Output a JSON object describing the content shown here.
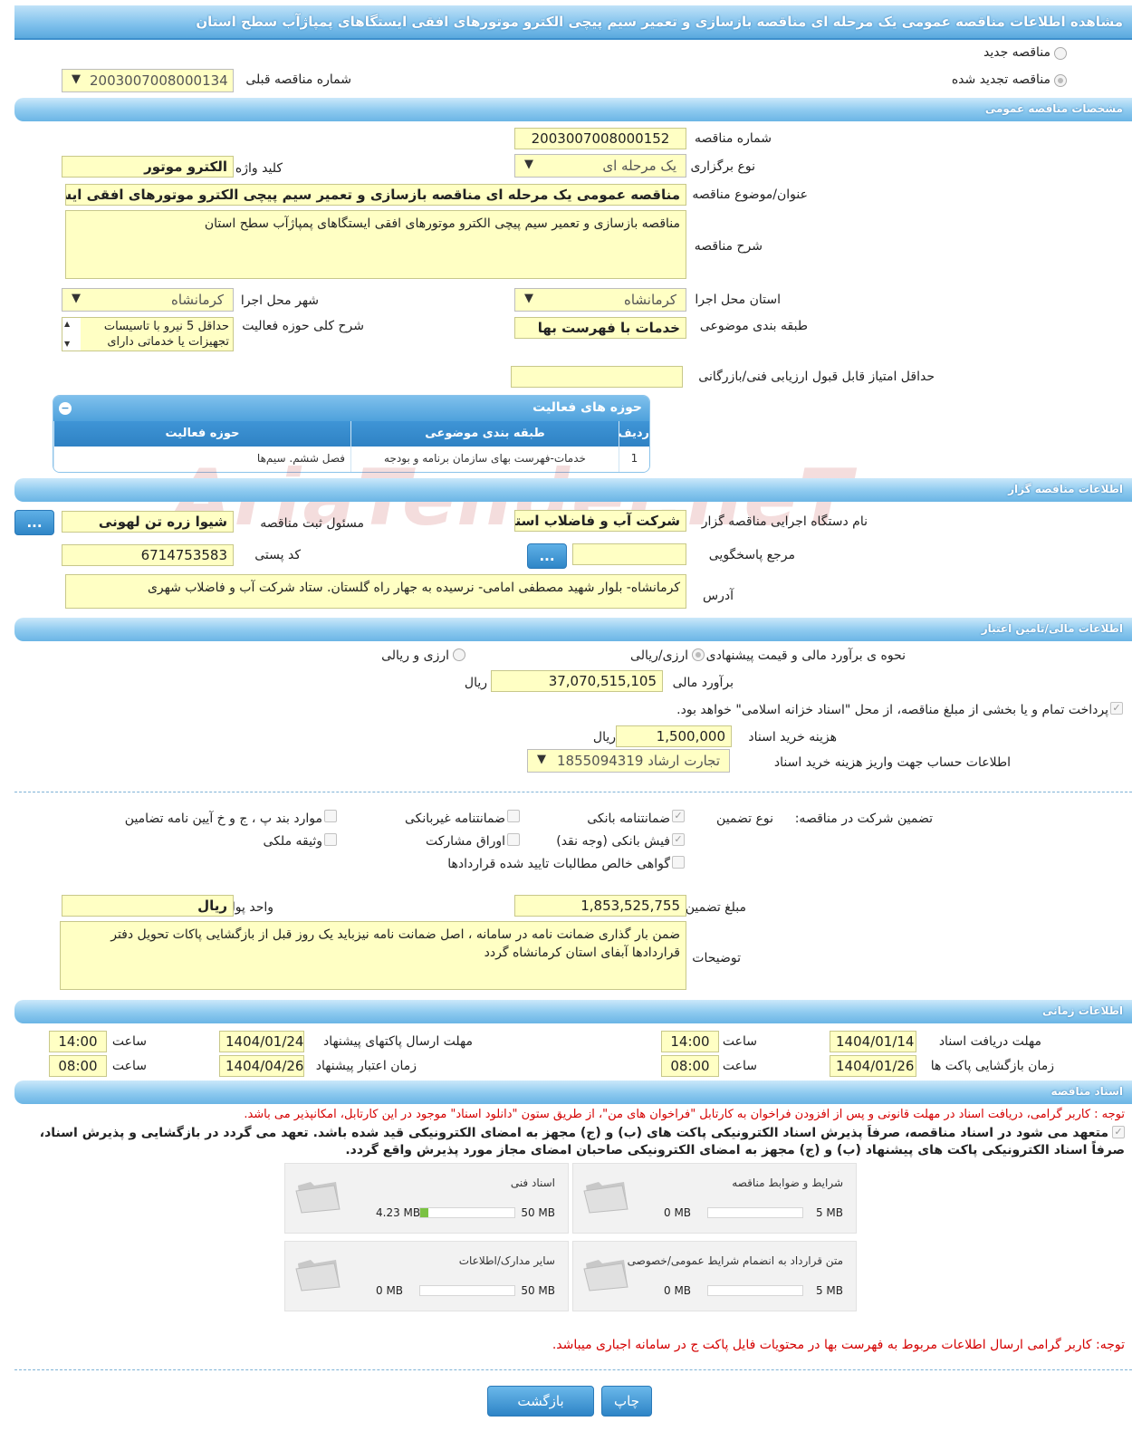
{
  "page_title": "مشاهده اطلاعات مناقصه عمومی یک مرحله ای مناقصه بازسازی و تعمیر سیم پیچی الکترو موتورهای افقی ایستگاهای پمپاژآب سطح استان",
  "tender_type": {
    "new_label": "مناقصه جدید",
    "renewed_label": "مناقصه تجدید شده",
    "prev_number_label": "شماره مناقصه قبلی",
    "prev_number": "2003007008000134"
  },
  "sections": {
    "general": "مشخصات مناقصه عمومی",
    "organizer": "اطلاعات مناقصه گزار",
    "finance": "اطلاعات مالی/تامین اعتبار",
    "timing": "اطلاعات زمانی",
    "documents": "اسناد مناقصه"
  },
  "general": {
    "number_label": "شماره مناقصه",
    "number": "2003007008000152",
    "holding_type_label": "نوع برگزاری",
    "holding_type": "یک مرحله ای",
    "keyword_label": "کلید واژه",
    "keyword": "الکترو موتور",
    "subject_label": "عنوان/موضوع مناقصه",
    "subject": "مناقصه عمومی یک مرحله ای مناقصه بازسازی و تعمیر سیم پیچی الکترو موتورهای افقی ایستگاهای",
    "description_label": "شرح مناقصه",
    "description": "مناقصه بازسازی و تعمیر سیم پیچی الکترو موتورهای افقی ایستگاهای پمپاژآب سطح استان",
    "province_label": "استان محل اجرا",
    "province": "کرمانشاه",
    "city_label": "شهر محل اجرا",
    "city": "کرمانشاه",
    "category_label": "طبقه بندی موضوعی",
    "category": "خدمات با فهرست بها",
    "activity_desc_label": "شرح کلی حوزه فعالیت",
    "activity_desc_line1": "حداقل 5 نیرو با تاسیسات",
    "activity_desc_line2": "تجهیزات یا خدماتی دارای",
    "min_score_label": "حداقل امتیاز قابل قبول ارزیابی فنی/بازرگانی",
    "min_score": ""
  },
  "activity_grid": {
    "title": "حوزه های فعالیت",
    "toggle": "−",
    "columns": [
      "ردیف",
      "طبقه بندی موضوعی",
      "حوزه فعالیت"
    ],
    "rows": [
      [
        "1",
        "خدمات-فهرست بهای سازمان برنامه و بودجه",
        "فصل ششم. سیم‌ها"
      ]
    ]
  },
  "watermark": "AriaTender.neT",
  "organizer": {
    "org_name_label": "نام دستگاه اجرایی مناقصه گزار",
    "org_name": "شرکت آب و فاضلاب استان",
    "registrar_label": "مسئول ثبت مناقصه",
    "registrar": "شیوا زره تن لهونی",
    "reference_label": "مرجع پاسخگویی",
    "reference": "",
    "postal_label": "کد پستی",
    "postal": "6714753583",
    "address_label": "آدرس",
    "address": "کرمانشاه- بلوار شهید مصطفی امامی- نرسیده به جهار راه گلستان. ستاد شرکت  آب و فاضلاب شهری",
    "dots": "..."
  },
  "finance": {
    "estimate_method_label": "نحوه ی برآورد مالی و قیمت پیشنهادی",
    "method_rial": "ارزی/ریالی",
    "method_fx": "ارزی و ریالی",
    "estimate_label": "برآورد مالی",
    "estimate": "37,070,515,105",
    "unit": "ریال",
    "treasury_note": "پرداخت تمام و یا بخشی از مبلغ مناقصه، از محل \"اسناد خزانه اسلامی\" خواهد بود.",
    "doc_fee_label": "هزینه خرید اسناد",
    "doc_fee": "1,500,000",
    "account_label": "اطلاعات حساب جهت واریز هزینه خرید اسناد",
    "account": "تجارت ارشاد 1855094319"
  },
  "guarantee": {
    "participation_label": "تضمین شرکت در مناقصه:",
    "type_label": "نوع تضمین",
    "options": {
      "bank_guarantee": "ضمانتنامه بانکی",
      "nonbank_guarantee": "ضمانتنامه غیربانکی",
      "clauses": "موارد بند پ ، ج و خ آیین نامه تضامین",
      "bank_receipt": "فیش بانکی (وجه نقد)",
      "bonds": "اوراق مشارکت",
      "property": "وثیقه ملکی",
      "certificate": "گواهی خالص مطالبات تایید شده قراردادها"
    },
    "amount_label": "مبلغ تضمین",
    "amount": "1,853,525,755",
    "currency_label": "واحد پول",
    "currency": "ریال",
    "notes_label": "توضیحات",
    "notes": "ضمن بار گذاری ضمانت نامه در سامانه ، اصل ضمانت نامه نیزباید یک روز قبل از بازگشایی پاکات تحویل دفتر قراردادها آبفای استان کرمانشاه گردد"
  },
  "timing": {
    "doc_receive_label": "مهلت دریافت اسناد",
    "doc_receive_date": "1404/01/14",
    "doc_receive_time": "14:00",
    "submit_label": "مهلت ارسال پاکتهای پیشنهاد",
    "submit_date": "1404/01/24",
    "submit_time": "14:00",
    "open_label": "زمان بازگشایی پاکت ها",
    "open_date": "1404/01/26",
    "open_time": "08:00",
    "validity_label": "زمان اعتبار پیشنهاد",
    "validity_date": "1404/04/26",
    "validity_time": "08:00",
    "time_label": "ساعت"
  },
  "documents": {
    "notice1": "توجه : کاربر گرامی، دریافت اسناد در مهلت قانونی و پس از افزودن فراخوان به کارتابل \"فراخوان های من\"، از طریق ستون \"دانلود اسناد\" موجود در این کارتابل، امکانپذیر می باشد.",
    "commit_line1": "متعهد می شود در اسناد مناقصه، صرفاً پذیرش اسناد الکترونیکی پاکت های (ب) و (ج) مجهز به امضای الکترونیکی قید شده باشد. تعهد می گردد در بازگشایی و پذیرش اسناد،",
    "commit_line2": "صرفاً اسناد الکترونیکی پاکت های پیشنهاد (ب) و (ج) مجهز به امضای الکترونیکی صاحبان امضای مجاز مورد پذیرش واقع گردد.",
    "cards": [
      {
        "title": "شرایط و ضوابط مناقصه",
        "max": "5 MB",
        "current": "0 MB",
        "fill": 0
      },
      {
        "title": "اسناد فنی",
        "max": "50 MB",
        "current": "4.23 MB",
        "fill": 0.085
      },
      {
        "title": "متن قرارداد به انضمام شرایط عمومی/خصوصی",
        "max": "5 MB",
        "current": "0 MB",
        "fill": 0
      },
      {
        "title": "سایر مدارک/اطلاعات",
        "max": "50 MB",
        "current": "0 MB",
        "fill": 0
      }
    ],
    "notice2": "توجه: کاربر گرامی ارسال اطلاعات مربوط به فهرست بها در محتویات فایل پاکت ج در سامانه اجباری میباشد."
  },
  "buttons": {
    "print": "چاپ",
    "back": "بازگشت"
  }
}
